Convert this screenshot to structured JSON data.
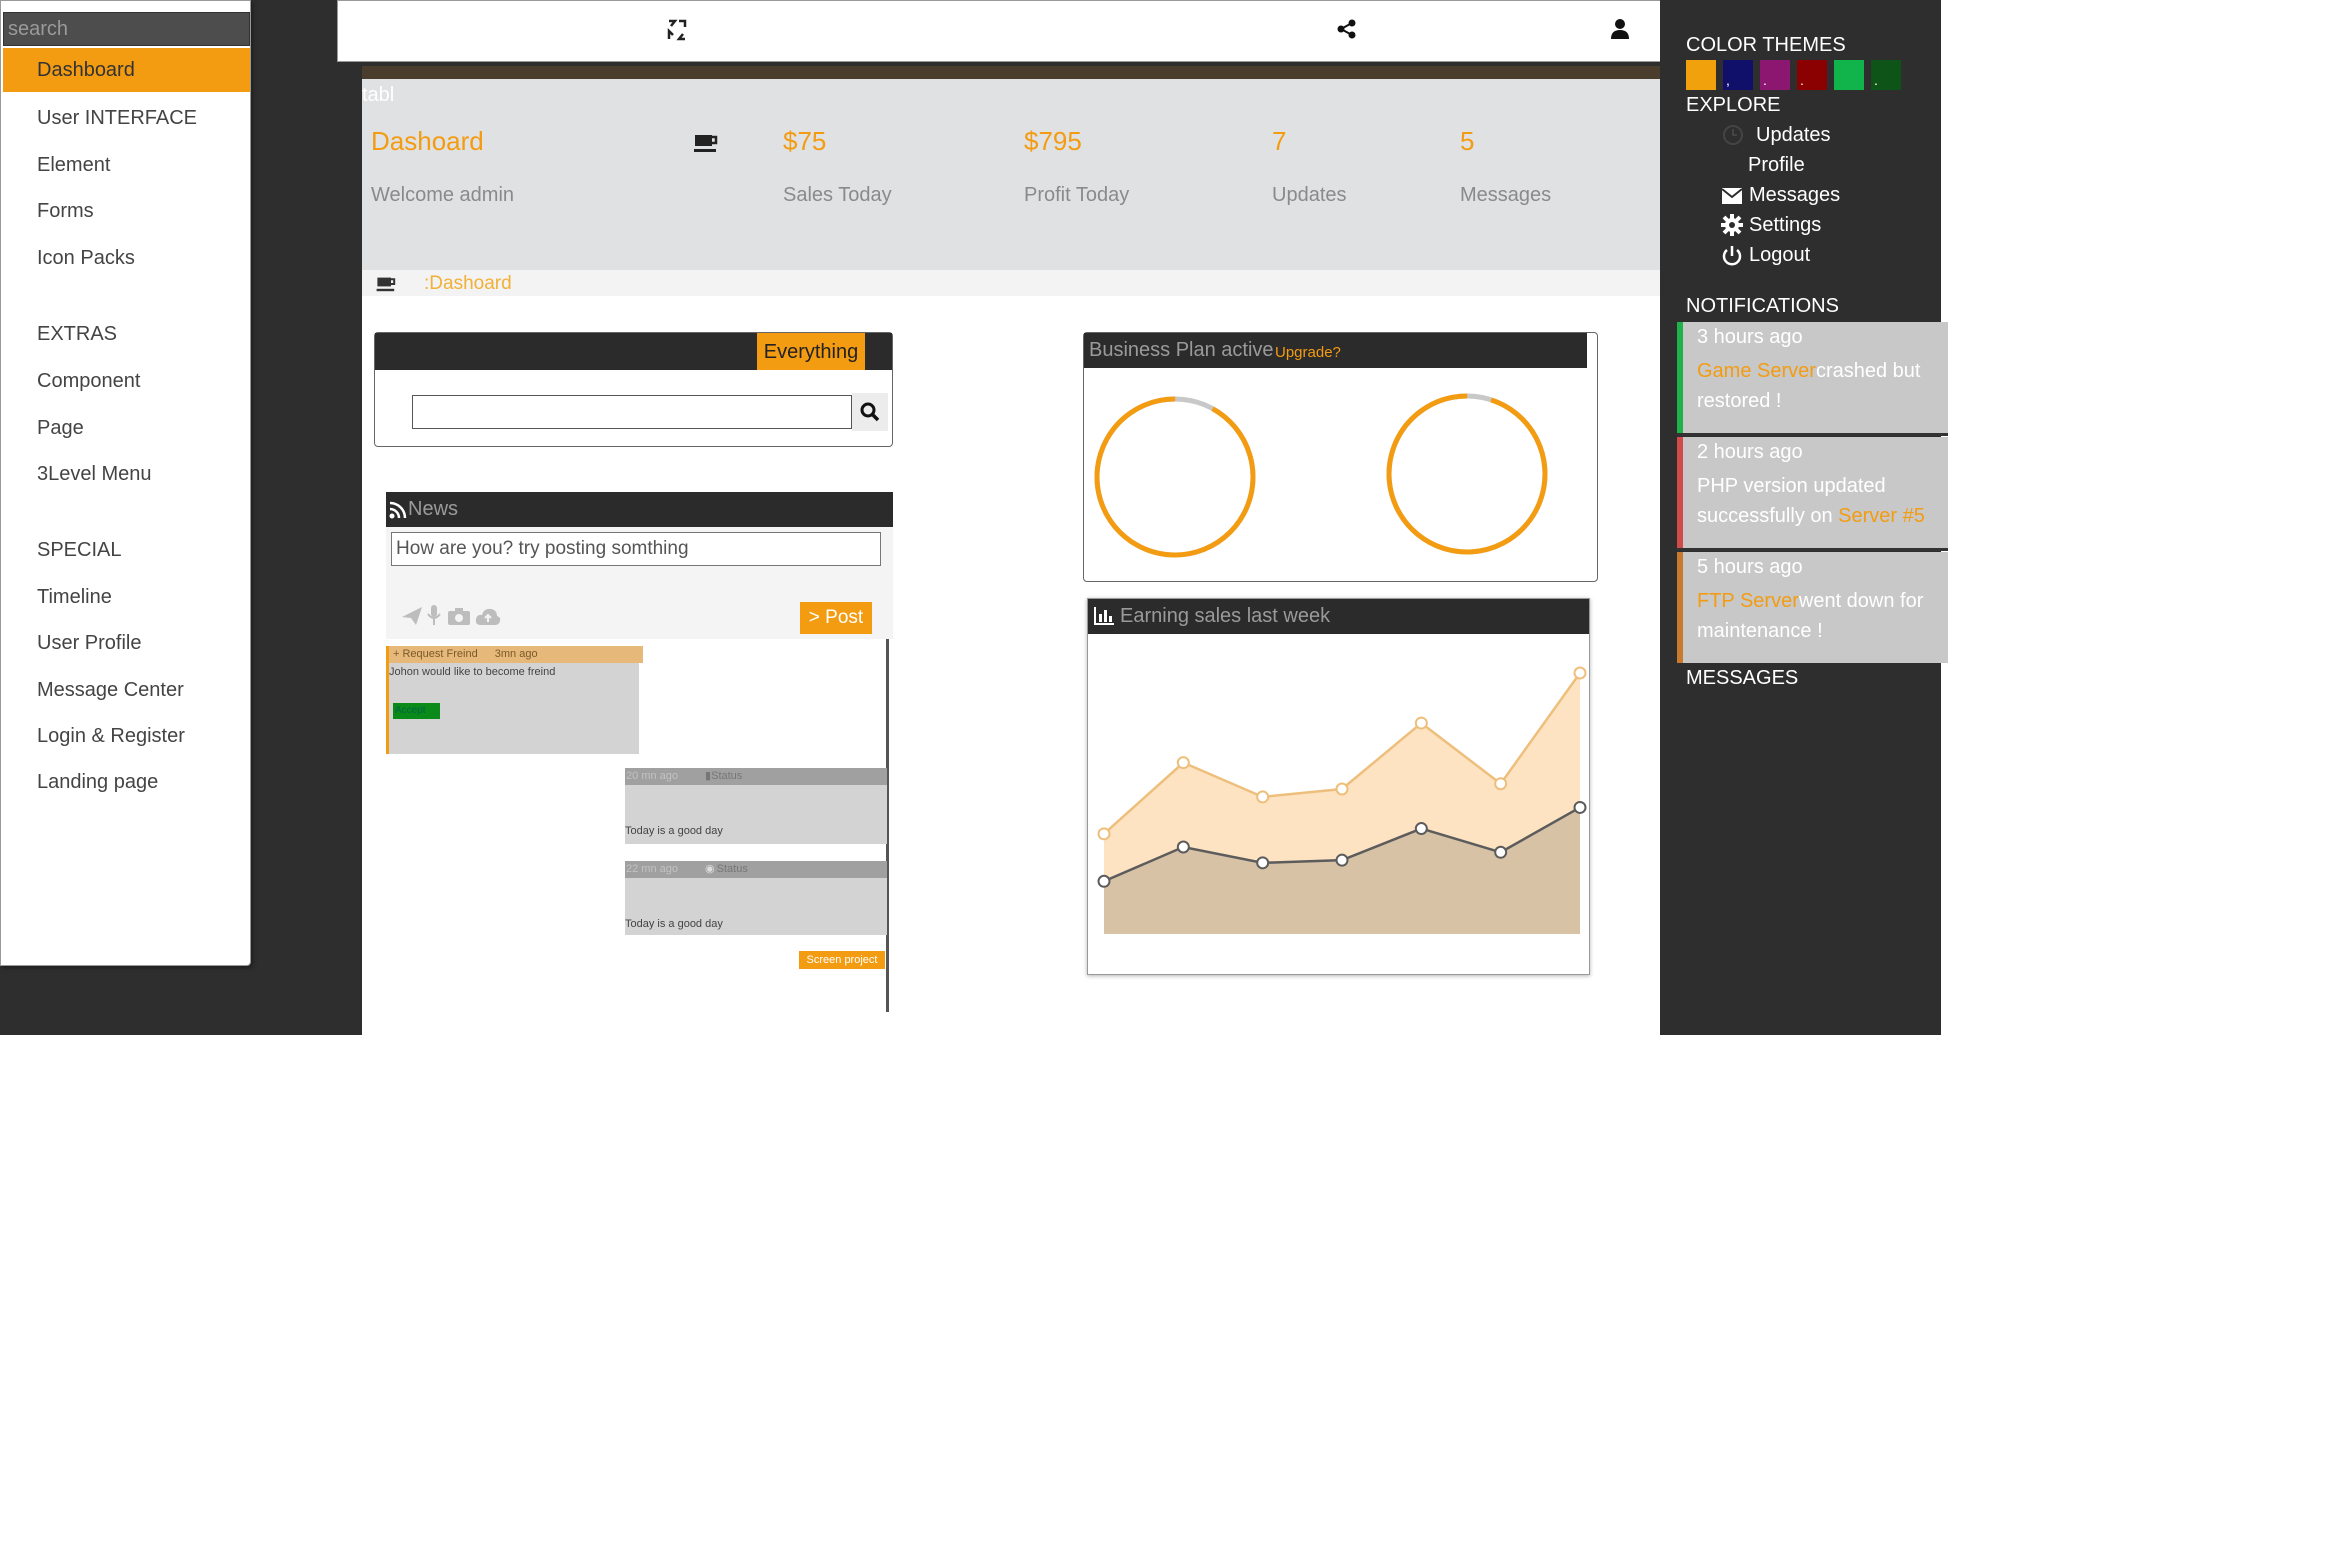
{
  "sidebar": {
    "search_placeholder": "search",
    "items": [
      {
        "label": "Dashboard"
      },
      {
        "label": "User INTERFACE"
      },
      {
        "label": "Element"
      },
      {
        "label": "Forms"
      },
      {
        "label": "Icon Packs"
      }
    ],
    "extras_heading": "EXTRAS",
    "extras": [
      {
        "label": "Component"
      },
      {
        "label": "Page"
      },
      {
        "label": "3Level Menu"
      }
    ],
    "special_heading": "SPECIAL",
    "special": [
      {
        "label": "Timeline"
      },
      {
        "label": "User Profile"
      },
      {
        "label": "Message Center"
      },
      {
        "label": "Login & Register"
      },
      {
        "label": "Landing page"
      }
    ]
  },
  "topbar": {
    "icons": [
      "logo-icon",
      "share-icon",
      "user-icon"
    ]
  },
  "header": {
    "tab_label": "tabl",
    "title": "Dashoard",
    "welcome": "Welcome admin",
    "stats": [
      {
        "value": "$75",
        "label": "Sales Today"
      },
      {
        "value": "$795",
        "label": "Profit Today"
      },
      {
        "value": "7",
        "label": "Updates"
      },
      {
        "value": "5",
        "label": "Messages"
      }
    ],
    "breadcrumb": ":Dashoard"
  },
  "search_widget": {
    "tab": "Everything",
    "value": ""
  },
  "news": {
    "title": "News",
    "placeholder": "How are you? try posting somthing",
    "post_button": "> Post",
    "feed": [
      {
        "head": "+ Request Freind",
        "time": "3mn ago",
        "text": "Johon would like to become freind",
        "button": "Accept"
      },
      {
        "time": "20 mn ago",
        "type": "Status",
        "text": "Today is a good day"
      },
      {
        "time": "22 mn ago",
        "type": "Status",
        "text": "Today is a good day"
      }
    ],
    "screen_button": "Screen project"
  },
  "business": {
    "title": "Business Plan active",
    "upgrade": "Upgrade?",
    "gauges": [
      {
        "fraction": 0.92
      },
      {
        "fraction": 0.95
      }
    ]
  },
  "earnings": {
    "title": "Earning sales last week"
  },
  "chart_data": {
    "type": "area",
    "title": "Earning sales last week",
    "x": [
      1,
      2,
      3,
      4,
      5,
      6,
      7
    ],
    "series": [
      {
        "values": [
          38,
          65,
          52,
          55,
          80,
          57,
          99
        ],
        "color": "#f0c487"
      },
      {
        "values": [
          20,
          33,
          27,
          28,
          40,
          31,
          48
        ],
        "color": "#666666"
      }
    ],
    "ylim": [
      0,
      110
    ],
    "grid": false,
    "legend": "none"
  },
  "rightpanel": {
    "themes_heading": "COLOR THEMES",
    "themes": [
      {
        "color": "#f0a10c",
        "mark": ""
      },
      {
        "color": "#10106b",
        "mark": ","
      },
      {
        "color": "#8c1770",
        "mark": "."
      },
      {
        "color": "#8b0000",
        "mark": "."
      },
      {
        "color": "#10b44b",
        "mark": ""
      },
      {
        "color": "#0e5418",
        "mark": "."
      }
    ],
    "explore_heading": "EXPLORE",
    "explore": [
      {
        "label": "Updates"
      },
      {
        "label": "Profile"
      },
      {
        "label": "Messages"
      },
      {
        "label": "Settings"
      },
      {
        "label": "Logout"
      }
    ],
    "notifications_heading": "NOTIFICATIONS",
    "notifications": [
      {
        "time": "3 hours ago",
        "highlight": "Game Server",
        "text": "crashed but restored !",
        "bar_color": "#20b24a"
      },
      {
        "time": "2 hours ago",
        "text": "PHP version updated successfully on ",
        "highlight": "Server #5",
        "bar_color": "#d24b4b"
      },
      {
        "time": "5 hours ago",
        "highlight": " FTP Server",
        "text": "went down for maintenance !",
        "bar_color": "#c87a2e"
      }
    ],
    "messages_heading": "MESSAGES"
  },
  "colors": {
    "accent": "#f39c12",
    "dark": "#2e2e2e",
    "panel": "#e0e1e3"
  }
}
